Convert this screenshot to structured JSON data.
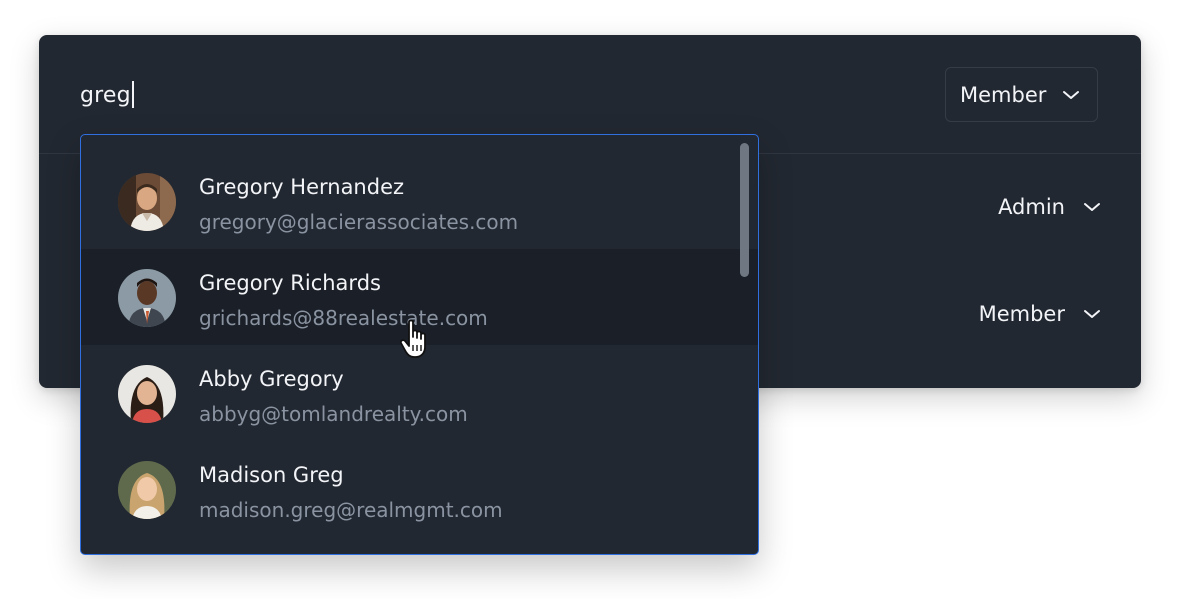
{
  "search": {
    "value": "greg"
  },
  "roles": {
    "new_member_role": "Member",
    "rows": [
      {
        "role": "Admin"
      },
      {
        "role": "Member"
      }
    ]
  },
  "suggestions": [
    {
      "name": "Gregory Hernandez",
      "email": "gregory@glacierassociates.com",
      "avatar": "avatar-photo",
      "highlighted": false
    },
    {
      "name": "Gregory Richards",
      "email": "grichards@88realestate.com",
      "avatar": "avatar-photo",
      "highlighted": true
    },
    {
      "name": "Abby Gregory",
      "email": "abbyg@tomlandrealty.com",
      "avatar": "avatar-photo",
      "highlighted": false
    },
    {
      "name": "Madison Greg",
      "email": "madison.greg@realmgmt.com",
      "avatar": "avatar-photo",
      "highlighted": false
    }
  ],
  "icons": {
    "chevron": "chevron-down-icon",
    "cursor": "hand-pointer-icon"
  },
  "colors": {
    "panel_bg": "#222831",
    "focus_border": "#2f6fe0",
    "hover_row": "#1b2028",
    "primary_text": "#f2f4f7",
    "secondary_text": "#8a93a1"
  }
}
